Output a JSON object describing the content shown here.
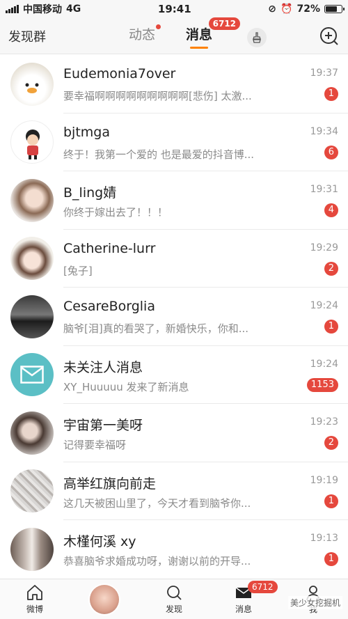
{
  "status": {
    "carrier": "中国移动",
    "network": "4G",
    "time": "19:41",
    "battery": "72%",
    "battery_level": 0.72
  },
  "nav": {
    "left": "发现群",
    "tabs": [
      {
        "label": "动态"
      },
      {
        "label": "消息",
        "badge": "6712"
      }
    ]
  },
  "messages": [
    {
      "name": "Eudemonia7over",
      "preview": "要幸福啊啊啊啊啊啊啊啊啊[悲伤] 太激...",
      "time": "19:37",
      "count": "1"
    },
    {
      "name": "bjtmga",
      "preview": "终于！我第一个爱的 也是最爱的抖音博...",
      "time": "19:34",
      "count": "6"
    },
    {
      "name": "B_ling婧",
      "preview": "你终于嫁出去了！！！",
      "time": "19:31",
      "count": "4"
    },
    {
      "name": "Catherine-lurr",
      "preview": "[兔子]",
      "time": "19:29",
      "count": "2"
    },
    {
      "name": "CesareBorglia",
      "preview": "脑爷[泪]真的看哭了，新婚快乐，你和...",
      "time": "19:24",
      "count": "1"
    },
    {
      "name": "未关注人消息",
      "preview": "XY_Huuuuu 发来了新消息",
      "time": "19:24",
      "count": "1153"
    },
    {
      "name": "宇宙第一美呀",
      "preview": "记得要幸福呀",
      "time": "19:23",
      "count": "2"
    },
    {
      "name": "高举红旗向前走",
      "preview": "这几天被困山里了，今天才看到脑爷你...",
      "time": "19:19",
      "count": "1"
    },
    {
      "name": "木槿何溪 xy",
      "preview": "恭喜脑爷求婚成功呀，谢谢以前的开导...",
      "time": "19:13",
      "count": "1"
    }
  ],
  "tabbar": {
    "home": "微博",
    "discover": "发现",
    "messages": "消息",
    "messages_badge": "6712",
    "me": "我"
  },
  "watermark": "美少女挖掘机",
  "colors": {
    "accent": "#ff8200",
    "badge": "#e5483d",
    "mail": "#5bbfc5"
  }
}
